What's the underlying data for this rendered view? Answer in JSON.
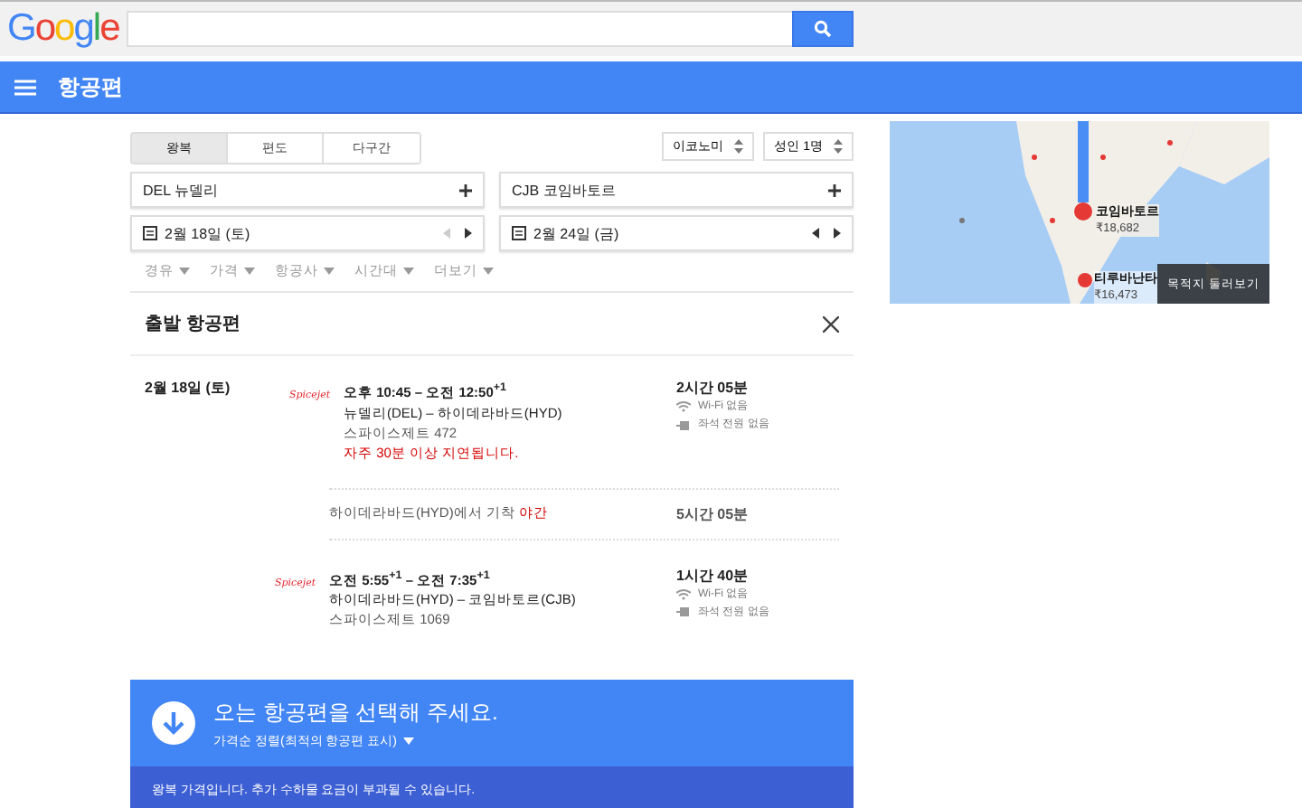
{
  "logo": "Google",
  "nav": {
    "title": "항공편"
  },
  "trip_types": [
    {
      "label": "왕복",
      "selected": true
    },
    {
      "label": "편도",
      "selected": false
    },
    {
      "label": "다구간",
      "selected": false
    }
  ],
  "cabin": "이코노미",
  "passengers": "성인 1명",
  "origin": "DEL 뉴델리",
  "destination": "CJB 코임바토르",
  "dates": [
    {
      "label": "2월 18일 (토)",
      "prev_disabled": true
    },
    {
      "label": "2월 24일 (금)",
      "prev_disabled": false
    }
  ],
  "filters": [
    "경유",
    "가격",
    "항공사",
    "시간대",
    "더보기"
  ],
  "results": {
    "title": "출발 항공편",
    "date": "2월 18일 (토)",
    "segments": [
      {
        "airline": "Spicejet",
        "times": "오후 10:45 – 오전 12:50$^{+1}$",
        "route": "뉴델리(DEL) – 하이데라바드(HYD)",
        "flight": "스파이스제트 472",
        "delay": "자주 30분 이상 지연됩니다.",
        "duration": "2시간 05분",
        "amenities": [
          "Wi-Fi 없음",
          "좌석 전원 없음"
        ]
      },
      {
        "airline": "Spicejet",
        "times": "오전 5:55$^{+1}$ – 오전 7:35$^{+1}$",
        "route": "하이데라바드(HYD) – 코임바토르(CJB)",
        "flight": "스파이스제트 1069",
        "duration": "1시간 40분",
        "amenities": [
          "Wi-Fi 없음",
          "좌석 전원 없음"
        ]
      }
    ],
    "layover": {
      "text": "하이데라바드(HYD)에서 기착",
      "warning": "야간",
      "duration": "5시간 05분"
    }
  },
  "banner": {
    "title": "오는 항공편을 선택해 주세요.",
    "sort": "가격순 정렬(최적의 항공편 표시)",
    "note_before": "왕복 가격입니다.",
    "note_link": "추가 수하물 요금",
    "note_after": "이 부과될 수 있습니다."
  },
  "map": {
    "labels": [
      {
        "name": "코임바토르",
        "price": "₹18,682"
      },
      {
        "name": "티루바난타",
        "price": "₹16,473"
      }
    ],
    "button": "목적지 둘러보기"
  }
}
